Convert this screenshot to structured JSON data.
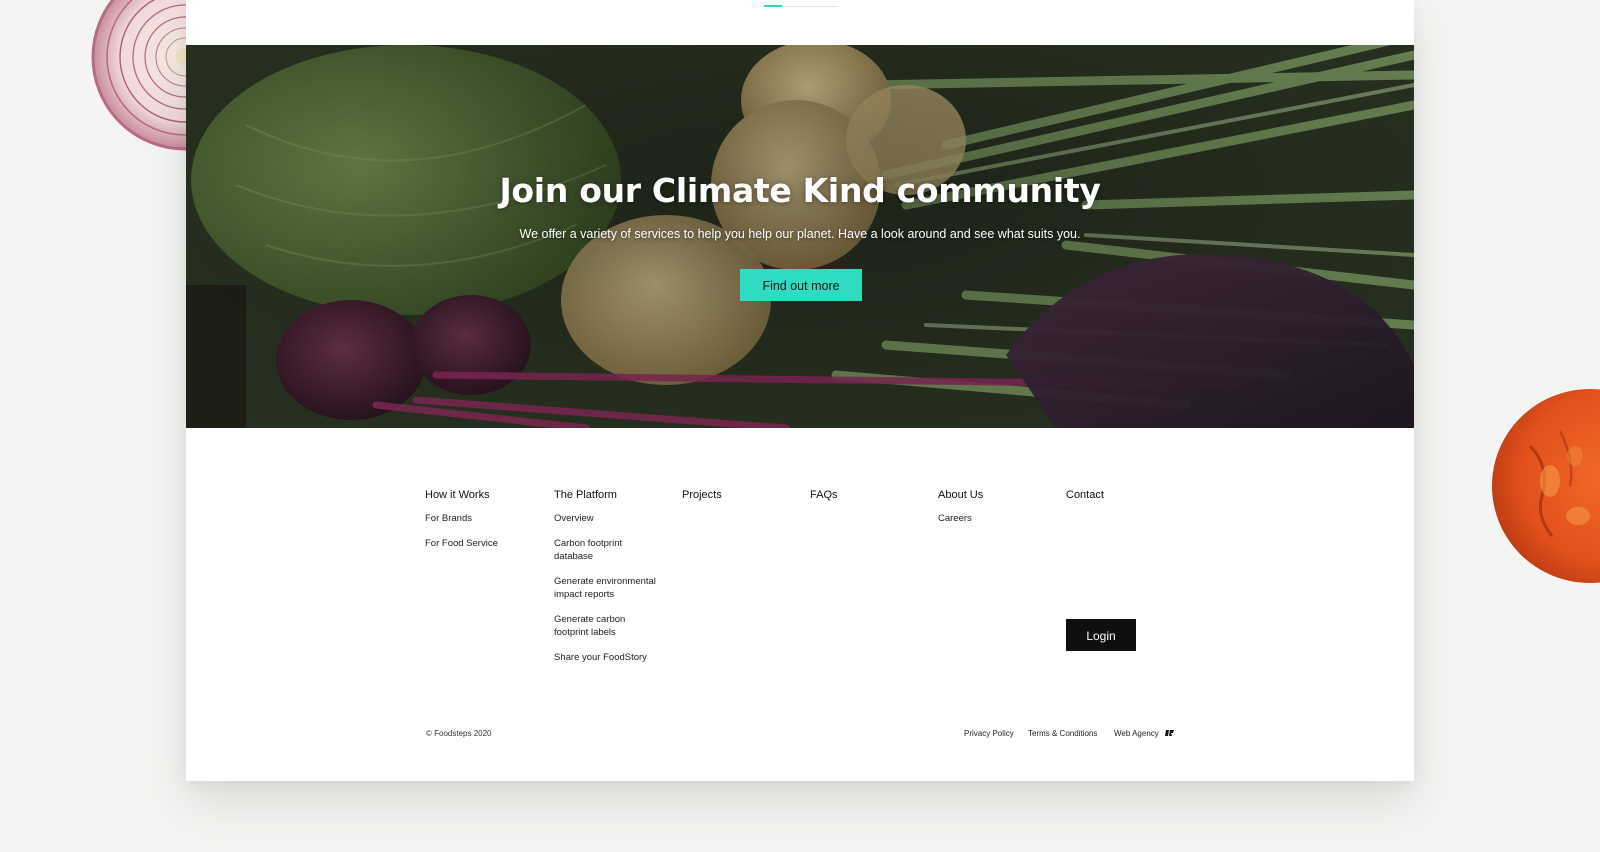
{
  "hero": {
    "title": "Join our Climate Kind community",
    "subtitle": "We offer a variety of services to help you help our planet. Have a look around and see what suits you.",
    "cta_label": "Find out more"
  },
  "footer": {
    "columns": [
      {
        "heading": "How it Works",
        "links": [
          "For Brands",
          "For Food Service"
        ]
      },
      {
        "heading": "The Platform",
        "links": [
          "Overview",
          "Carbon footprint database",
          "Generate environmental impact reports",
          "Generate carbon footprint labels",
          "Share your FoodStory"
        ]
      },
      {
        "heading": "Projects",
        "links": []
      },
      {
        "heading": "FAQs",
        "links": []
      },
      {
        "heading": "About Us",
        "links": [
          "Careers"
        ]
      },
      {
        "heading": "Contact",
        "links": []
      }
    ],
    "login_label": "Login",
    "copyright": "© Foodsteps 2020",
    "legal": {
      "privacy": "Privacy Policy",
      "terms": "Terms & Conditions",
      "agency": "Web Agency"
    }
  },
  "colors": {
    "accent": "#2fdcc2",
    "login_bg": "#0f0f10",
    "page_bg": "#f4f5f2"
  },
  "icons": {
    "agency_logo": "web-agency-logo-icon",
    "onion": "onion-slice-decoration",
    "tomato": "tomato-slice-decoration"
  }
}
